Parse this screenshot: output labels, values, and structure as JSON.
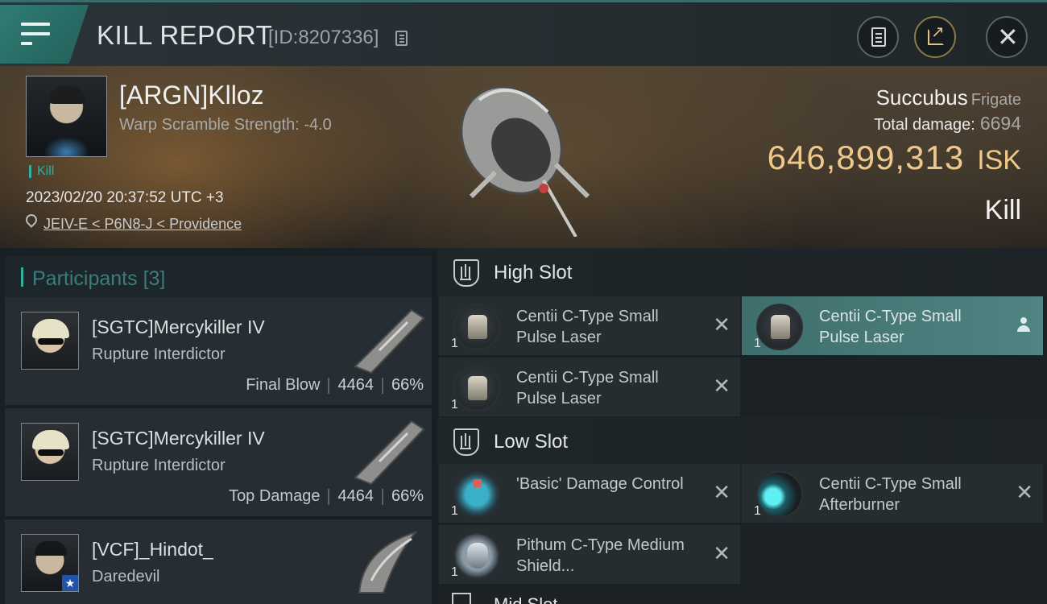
{
  "header": {
    "title": "KILL REPORT",
    "report_id": "[ID:8207336]"
  },
  "victim": {
    "name": "[ARGN]Klloz",
    "subtitle": "Warp Scramble Strength: -4.0",
    "tag": "Kill",
    "datetime": "2023/02/20 20:37:52 UTC +3",
    "location": "JEIV-E < P6N8-J < Providence",
    "ship_name": "Succubus",
    "ship_class": "Frigate",
    "total_damage_label": "Total damage:",
    "total_damage": "6694",
    "isk_value": "646,899,313",
    "isk_unit": "ISK",
    "result": "Kill"
  },
  "participants": {
    "label": "Participants",
    "count": "[3]",
    "items": [
      {
        "name": "[SGTC]Mercykiller IV",
        "ship": "Rupture Interdictor",
        "stat_label": "Final Blow",
        "damage": "4464",
        "percent": "66%"
      },
      {
        "name": "[SGTC]Mercykiller IV",
        "ship": "Rupture Interdictor",
        "stat_label": "Top Damage",
        "damage": "4464",
        "percent": "66%"
      },
      {
        "name": "[VCF]_Hindot_",
        "ship": "Daredevil"
      }
    ]
  },
  "fittings": {
    "high_slot_label": "High Slot",
    "low_slot_label": "Low Slot",
    "mid_slot_label": "Mid Slot",
    "high": [
      {
        "name": "Centii C-Type Small Pulse Laser",
        "qty": "1"
      },
      {
        "name": "Centii C-Type Small Pulse Laser",
        "qty": "1"
      },
      {
        "name": "Centii C-Type Small Pulse Laser",
        "qty": "1"
      }
    ],
    "low": [
      {
        "name": "'Basic' Damage Control",
        "qty": "1"
      },
      {
        "name": "Centii C-Type Small Afterburner",
        "qty": "1"
      },
      {
        "name": "Pithum C-Type Medium Shield...",
        "qty": "1"
      }
    ]
  },
  "colors": {
    "accent_teal": "#2fb0a2",
    "isk_gold": "#eec98a",
    "selected_module": "#4f8482"
  }
}
